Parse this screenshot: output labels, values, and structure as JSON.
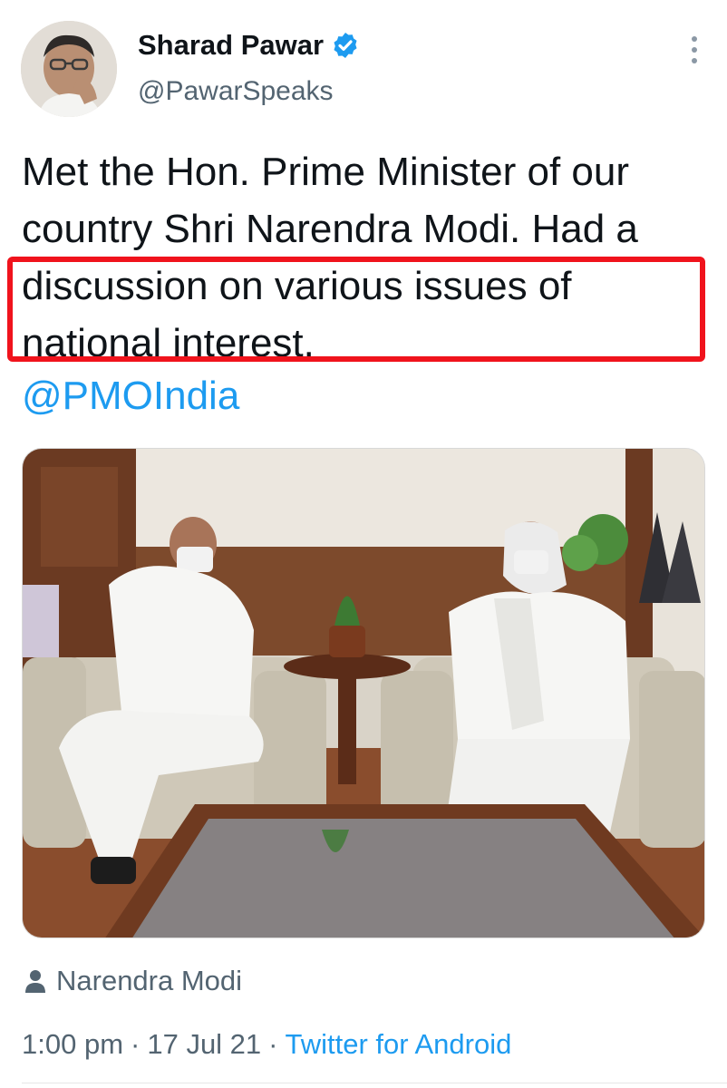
{
  "author": {
    "display_name": "Sharad Pawar",
    "handle": "@PawarSpeaks",
    "verified": true,
    "avatar_icon": "profile-photo"
  },
  "tweet": {
    "text": "Met the Hon. Prime Minister of our country Shri Narendra Modi. Had a discussion on various issues of national interest.",
    "mention": "@PMOIndia",
    "highlight_color": "#f0131c"
  },
  "media": {
    "tagged_person": "Narendra Modi"
  },
  "meta": {
    "time": "1:00 pm",
    "separator": "·",
    "date": "17 Jul 21",
    "source": "Twitter for Android"
  },
  "colors": {
    "text": "#0f1419",
    "secondary": "#536471",
    "link": "#1d9bf0",
    "verified": "#1d9bf0"
  },
  "icons": {
    "verified": "verified-badge-icon",
    "more": "more-vertical-icon",
    "person": "person-icon"
  }
}
